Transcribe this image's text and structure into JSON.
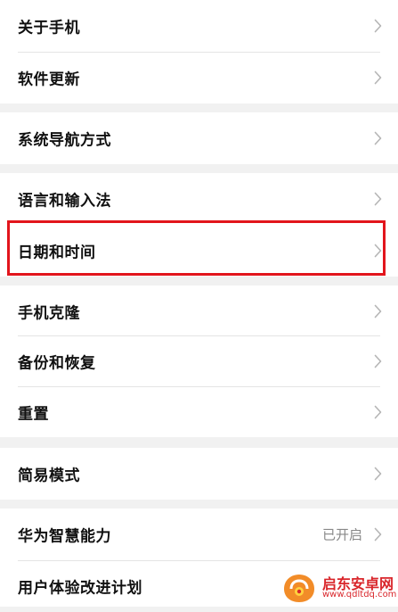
{
  "groups": [
    {
      "items": [
        {
          "label": "关于手机"
        },
        {
          "label": "软件更新"
        }
      ]
    },
    {
      "items": [
        {
          "label": "系统导航方式"
        }
      ]
    },
    {
      "items": [
        {
          "label": "语言和输入法"
        },
        {
          "label": "日期和时间"
        }
      ]
    },
    {
      "items": [
        {
          "label": "手机克隆"
        },
        {
          "label": "备份和恢复"
        },
        {
          "label": "重置"
        }
      ]
    },
    {
      "items": [
        {
          "label": "简易模式"
        }
      ]
    },
    {
      "items": [
        {
          "label": "华为智慧能力",
          "status": "已开启"
        },
        {
          "label": "用户体验改进计划"
        }
      ]
    }
  ],
  "highlighted_item": "日期和时间",
  "watermark": {
    "title": "启东安卓网",
    "url": "www.qdltdq.com"
  },
  "colors": {
    "background": "#f1f1f1",
    "row_background": "#ffffff",
    "highlight_border": "#e2151c",
    "chevron": "#b5b5b5",
    "status_text": "#888888",
    "watermark": "#d9262b"
  },
  "icons": {
    "chevron": "chevron-right-icon"
  }
}
